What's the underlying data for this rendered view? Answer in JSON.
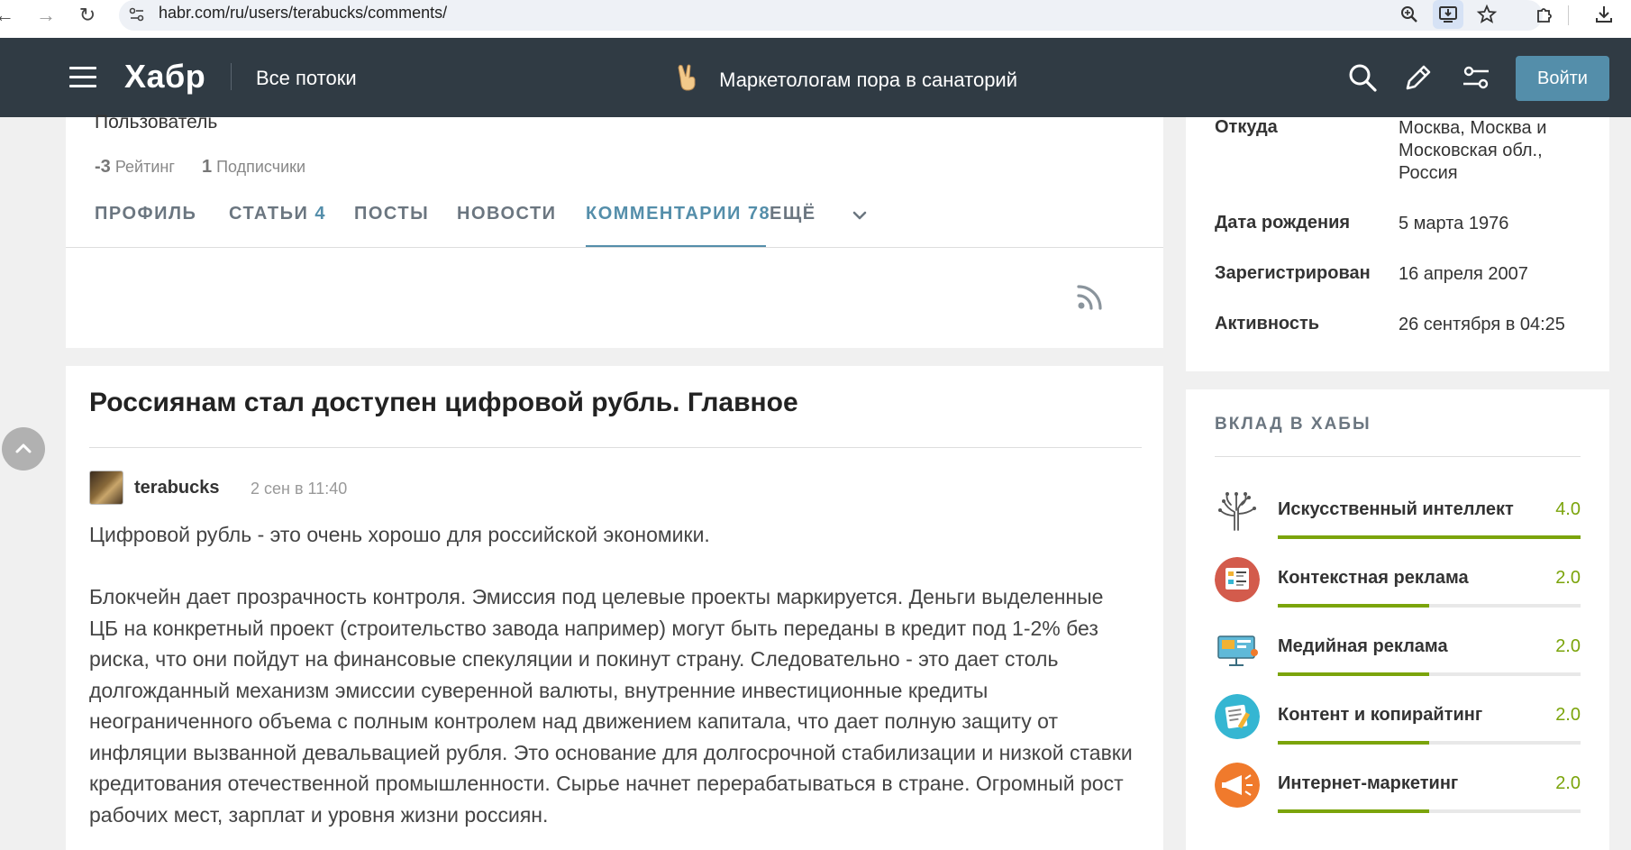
{
  "browser": {
    "url": "habr.com/ru/users/terabucks/comments/",
    "icons": [
      "back-icon",
      "forward-icon",
      "reload-icon",
      "site-info-icon",
      "zoom-icon",
      "install-app-icon",
      "bookmark-star-icon",
      "extensions-icon",
      "download-icon"
    ]
  },
  "header": {
    "logo": "Хабр",
    "all_flows": "Все потоки",
    "promo_text": "Маркетологам пора в санаторий",
    "login_label": "Войти"
  },
  "profile": {
    "role": "Пользователь",
    "rating_value": "-3",
    "rating_label": "Рейтинг",
    "followers_value": "1",
    "followers_label": "Подписчики",
    "tabs": [
      {
        "label": "ПРОФИЛЬ",
        "count": ""
      },
      {
        "label": "СТАТЬИ",
        "count": "4"
      },
      {
        "label": "ПОСТЫ",
        "count": ""
      },
      {
        "label": "НОВОСТИ",
        "count": ""
      },
      {
        "label": "КОММЕНТАРИИ",
        "count": "78"
      },
      {
        "label": "ЕЩЁ",
        "count": ""
      }
    ]
  },
  "comment": {
    "article_title": "Россиянам стал доступен цифровой рубль. Главное",
    "author": "terabucks",
    "date": "2 сен в 11:40",
    "paragraphs": [
      "Цифровой рубль - это очень хорошо для российской экономики.",
      "Блокчейн дает прозрачность контроля. Эмиссия под целевые проекты маркируется. Деньги выделенные ЦБ на конкретный проект (строительство завода например) могут быть переданы в кредит под 1-2% без риска, что они пойдут на финансовые спекуляции и покинут страну. Следовательно - это дает столь долгожданный механизм эмиссии суверенной валюты, внутренние инвестиционные кредиты неограниченного объема с полным контролем над движением капитала, что дает полную защиту от инфляции вызванной девальвацией рубля. Это основание для долгосрочной стабилизации и низкой ставки кредитования отечественной промышленности. Сырье начнет перерабатываться в стране. Огромный рост рабочих мест, зарплат и уровня жизни россиян."
    ]
  },
  "info": {
    "rows": [
      {
        "label": "Откуда",
        "value": "Москва, Москва и Московская обл., Россия"
      },
      {
        "label": "Дата рождения",
        "value": "5 марта 1976"
      },
      {
        "label": "Зарегистрирован",
        "value": "16 апреля 2007"
      },
      {
        "label": "Активность",
        "value": "26 сентября в 04:25"
      }
    ]
  },
  "hubs": {
    "title": "ВКЛАД В ХАБЫ",
    "items": [
      {
        "name": "Искусственный интеллект",
        "score": "4.0",
        "fill": 1.0,
        "color": "#ffffff"
      },
      {
        "name": "Контекстная реклама",
        "score": "2.0",
        "fill": 0.5,
        "color": "#d35b4c"
      },
      {
        "name": "Медийная реклама",
        "score": "2.0",
        "fill": 0.5,
        "color": "#ffffff"
      },
      {
        "name": "Контент и копирайтинг",
        "score": "2.0",
        "fill": 0.5,
        "color": "#35b6d2"
      },
      {
        "name": "Интернет-маркетинг",
        "score": "2.0",
        "fill": 0.5,
        "color": "#f07a2c"
      }
    ]
  },
  "colors": {
    "header_bg": "#303b44",
    "accent": "#548eaa",
    "hub_green": "#7ba40b"
  }
}
